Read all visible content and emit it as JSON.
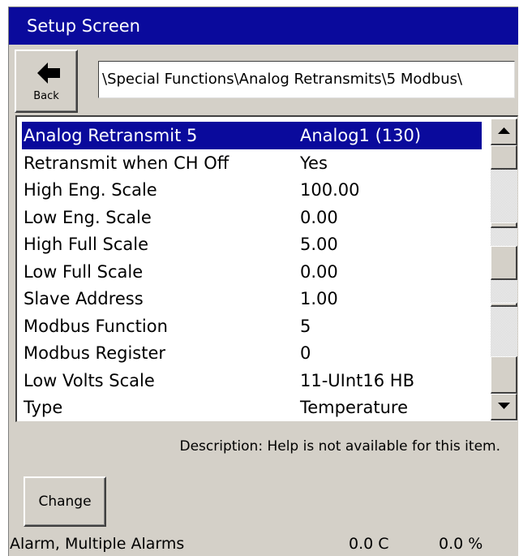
{
  "window": {
    "title": "Setup Screen"
  },
  "back_button": {
    "label": "Back",
    "icon": "arrow-left-icon"
  },
  "path": "\\Special Functions\\Analog Retransmits\\5 Modbus\\",
  "settings": [
    {
      "name": "Analog Retransmit 5",
      "value": "Analog1 (130)",
      "selected": true
    },
    {
      "name": "Retransmit when CH Off",
      "value": "Yes"
    },
    {
      "name": "High Eng. Scale",
      "value": "100.00"
    },
    {
      "name": "Low Eng. Scale",
      "value": "0.00"
    },
    {
      "name": "High Full Scale",
      "value": "5.00"
    },
    {
      "name": "Low Full Scale",
      "value": "0.00"
    },
    {
      "name": "Slave Address",
      "value": "1.00"
    },
    {
      "name": "Modbus Function",
      "value": "5"
    },
    {
      "name": "Modbus Register",
      "value": "0"
    },
    {
      "name": "Low Volts Scale",
      "value": "11-UInt16 HB"
    },
    {
      "name": "Type",
      "value": "Temperature"
    }
  ],
  "scrollbar": {
    "up_icon": "scroll-up-arrow-icon",
    "down_icon": "scroll-down-arrow-icon"
  },
  "description": "Description:  Help is not available for this item.",
  "change_button": {
    "label": "Change"
  },
  "status_bar": {
    "alarm": "Alarm, Multiple Alarms",
    "temperature": "0.0 C",
    "percent": "0.0 %"
  },
  "colors": {
    "title_bar": "#0a0a9c",
    "selection": "#0a0a9c",
    "panel": "#d4d0c8"
  }
}
